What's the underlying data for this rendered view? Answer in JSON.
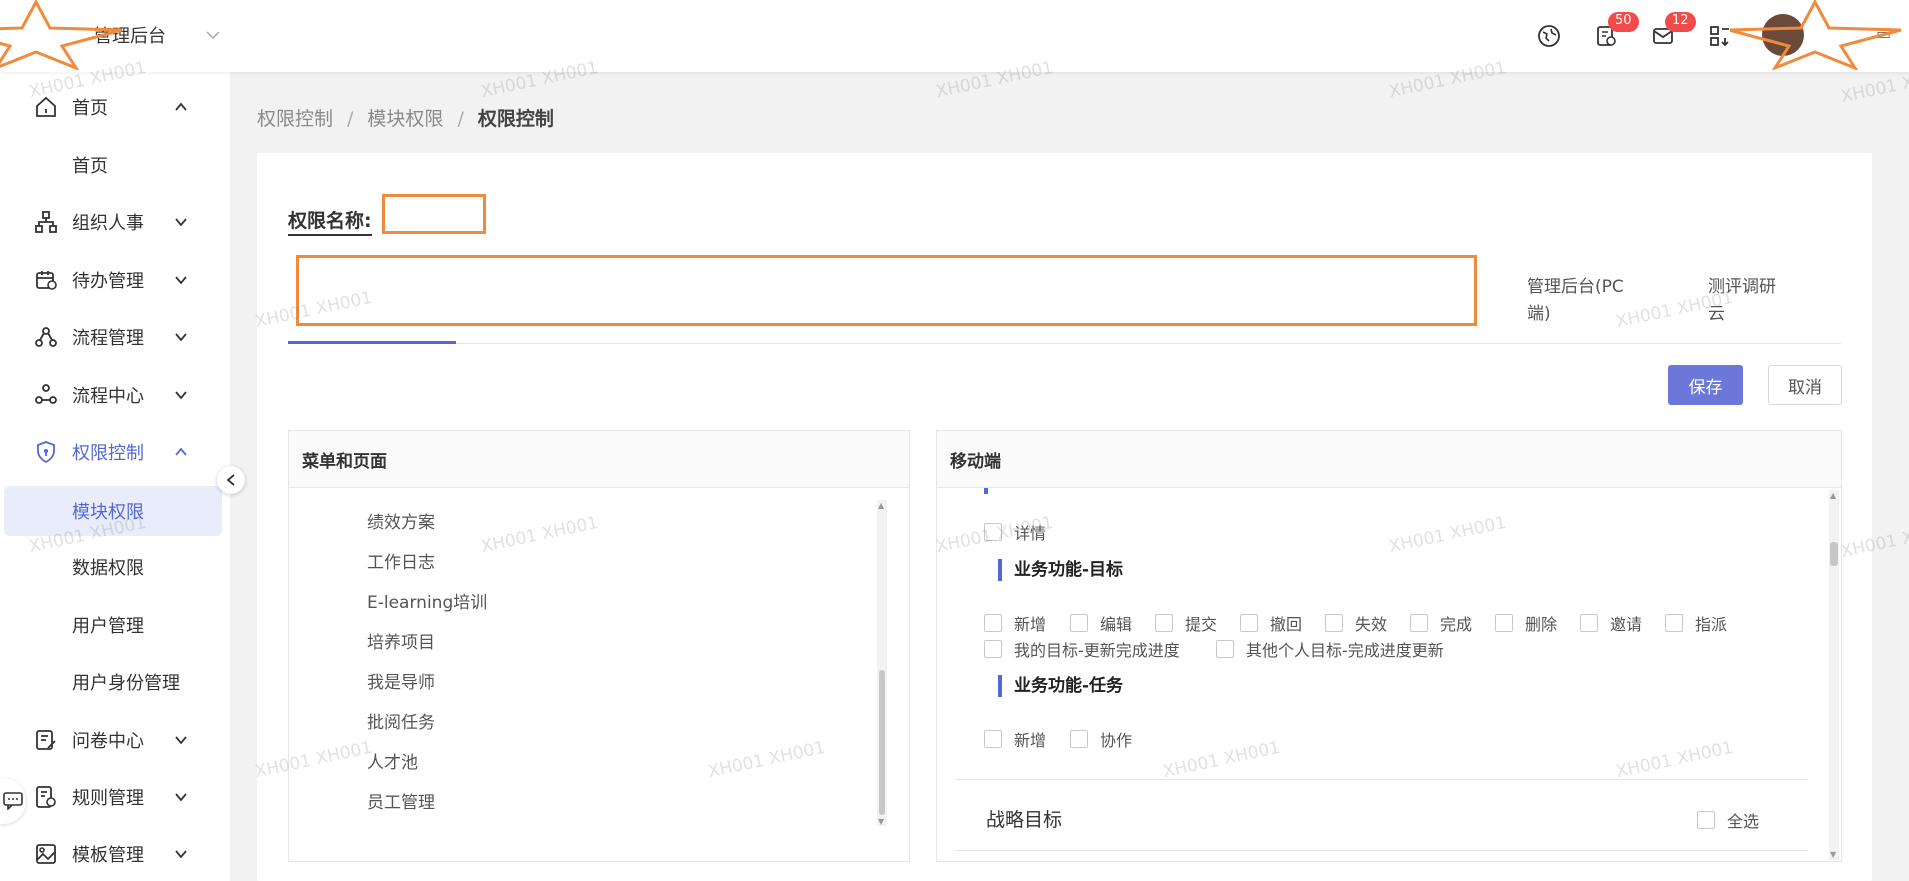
{
  "topbar": {
    "app_name": "管理后台",
    "todo_badge": "50",
    "mail_badge": "12"
  },
  "sidebar": {
    "items": [
      {
        "label": "首页",
        "icon": "home-icon",
        "expanded": true
      },
      {
        "label": "首页"
      },
      {
        "label": "组织人事",
        "icon": "org-icon"
      },
      {
        "label": "待办管理",
        "icon": "calendar-icon"
      },
      {
        "label": "流程管理",
        "icon": "flow-icon"
      },
      {
        "label": "流程中心",
        "icon": "flow-center-icon"
      },
      {
        "label": "权限控制",
        "icon": "shield-icon",
        "expanded": true,
        "active": true
      },
      {
        "label": "模块权限",
        "selected": true
      },
      {
        "label": "数据权限"
      },
      {
        "label": "用户管理"
      },
      {
        "label": "用户身份管理"
      },
      {
        "label": "问卷中心",
        "icon": "survey-icon"
      },
      {
        "label": "规则管理",
        "icon": "rule-icon"
      },
      {
        "label": "模板管理",
        "icon": "template-icon"
      }
    ]
  },
  "breadcrumb": {
    "level1": "权限控制",
    "sep": "/",
    "level2": "模块权限",
    "current": "权限控制"
  },
  "form": {
    "perm_name_label": "权限名称:",
    "tabs": [
      {
        "label": "管理后台(PC 端)"
      },
      {
        "label": "测评调研 云"
      }
    ],
    "save_label": "保存",
    "cancel_label": "取消"
  },
  "left_panel": {
    "title": "菜单和页面",
    "items": [
      "绩效方案",
      "工作日志",
      "E-learning培训",
      "培养项目",
      "我是导师",
      "批阅任务",
      "人才池",
      "员工管理"
    ]
  },
  "right_panel": {
    "title": "移动端",
    "detail_label": "详情",
    "sections": [
      {
        "title": "业务功能-目标",
        "row1": [
          "新增",
          "编辑",
          "提交",
          "撤回",
          "失效",
          "完成",
          "删除",
          "邀请",
          "指派"
        ],
        "row2": [
          "我的目标-更新完成进度",
          "其他个人目标-完成进度更新"
        ]
      },
      {
        "title": "业务功能-任务",
        "row1": [
          "新增",
          "协作"
        ]
      }
    ],
    "group_title": "战略目标",
    "select_all_label": "全选"
  },
  "watermark": "XH001 XH001"
}
